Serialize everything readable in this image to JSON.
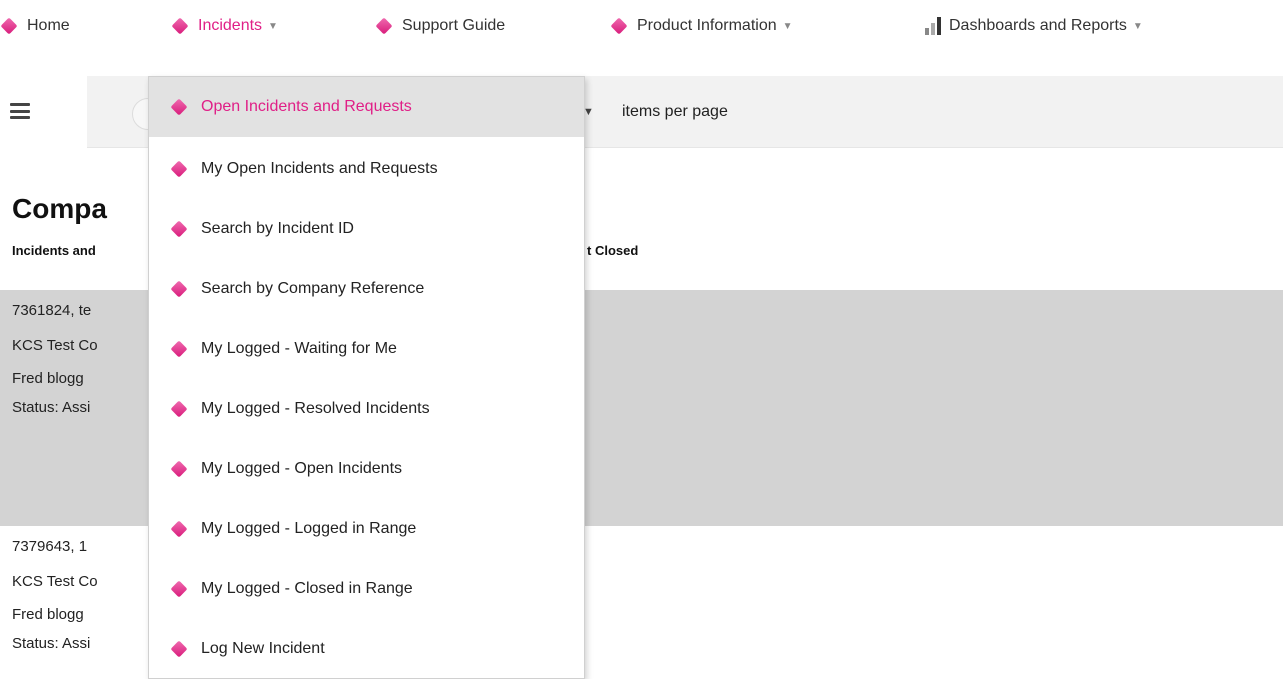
{
  "nav": {
    "home": "Home",
    "incidents": "Incidents",
    "support_guide": "Support Guide",
    "product_information": "Product Information",
    "dashboards": "Dashboards and Reports",
    "caret": "▼"
  },
  "toolbar": {
    "per_page_caret": "▼",
    "per_page_label": "items per page"
  },
  "page": {
    "title_visible": "Compa",
    "subtitle_left": "Incidents and",
    "subtitle_right": "t Closed"
  },
  "records": [
    {
      "line1": "7361824, te",
      "line2": "KCS Test Co",
      "line3": "Fred blogg",
      "line4": "Status: Assi"
    },
    {
      "line1": "7379643, 1",
      "line2": "KCS Test Co",
      "line3": "Fred blogg",
      "line4": "Status: Assi"
    }
  ],
  "dropdown": {
    "items": [
      "Open Incidents and Requests",
      "My Open Incidents and Requests",
      "Search by Incident ID",
      "Search by Company Reference",
      "My Logged - Waiting for Me",
      "My Logged - Resolved Incidents",
      "My Logged - Open Incidents",
      "My Logged - Logged in Range",
      "My Logged - Closed in Range",
      "Log New Incident"
    ]
  },
  "colors": {
    "accent": "#e01f87",
    "diamond_light": "#f06bb0",
    "diamond_dark": "#d81b7a",
    "selected_row": "#d3d3d3",
    "toolbar_bg": "#f2f2f2",
    "menu_hover": "#e2e2e2"
  },
  "icons": {
    "nav_item": "pink-diamond-icon",
    "dashboards": "bar-chart-icon",
    "menu": "hamburger-menu-icon"
  }
}
